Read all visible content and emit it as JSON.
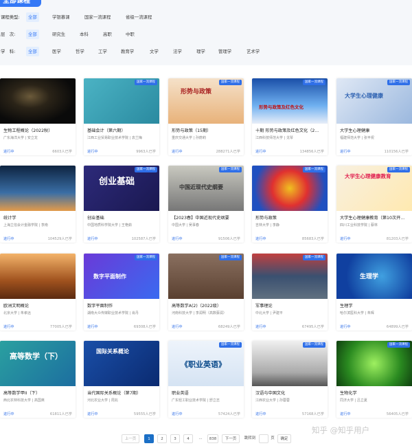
{
  "tab_all": "全部课程",
  "filters": {
    "type": {
      "label": "课程类型:",
      "options": [
        "全部",
        "学银慕课",
        "国家一流课程",
        "省级一流课程"
      ]
    },
    "level": {
      "label": "层　次:",
      "options": [
        "全部",
        "研究生",
        "本科",
        "高职",
        "中职"
      ]
    },
    "subject": {
      "label": "学　科:",
      "options": [
        "全部",
        "医学",
        "哲学",
        "工学",
        "教育学",
        "文学",
        "法学",
        "理学",
        "管理学",
        "艺术学"
      ]
    }
  },
  "badge_label": "国家一流课程",
  "courses": [
    {
      "title": "生物工程概论（2022秋）",
      "uni": "广东海洋大学 | 安立龙",
      "status": "进行中",
      "count": "6603人已学",
      "thumb_text": ""
    },
    {
      "title": "基础会计（第六期）",
      "uni": "江西工业贸易职业技术学院 | 袁兰梅",
      "status": "进行中",
      "count": "9963人已学",
      "thumb_text": ""
    },
    {
      "title": "形势与政策（15期）",
      "uni": "重庆交通大学 | 孙蔚莉",
      "status": "进行中",
      "count": "288271人已学",
      "thumb_text": "形势与政策"
    },
    {
      "title": "十期 形势与政策及红色文化（2...",
      "uni": "江西科技师范大学 | 戈琴",
      "status": "进行中",
      "count": "134856人已学",
      "thumb_text": "形势与政策及红色文化"
    },
    {
      "title": "大学生心理健康",
      "uni": "福建师范大学 | 张丰祝",
      "status": "进行中",
      "count": "110156人已学",
      "thumb_text": "大学生心理健康"
    },
    {
      "title": "统计学",
      "uni": "上海立信会计金融学院 | 李南",
      "status": "进行中",
      "count": "104529人已学",
      "thumb_text": ""
    },
    {
      "title": "创业基础",
      "uni": "中国地质科学院大学 | 王艳茹",
      "status": "进行中",
      "count": "102587人已学",
      "thumb_text": "创业基础"
    },
    {
      "title": "【2023春】中国近现代史纲要",
      "uni": "中国大学 | 吴事春",
      "status": "进行中",
      "count": "91506人已学",
      "thumb_text": "中国近现代史纲要"
    },
    {
      "title": "形势与政策",
      "uni": "吉林大学 | 李静",
      "status": "进行中",
      "count": "85683人已学",
      "thumb_text": ""
    },
    {
      "title": "大学生心理健康教育（第10次开...",
      "uni": "四川工业科技学院 | 蔡林",
      "status": "进行中",
      "count": "81203人已学",
      "thumb_text": "大学生心理健康教育"
    },
    {
      "title": "欧洲文明概论",
      "uni": "北京大学 | 朱孝远",
      "status": "进行中",
      "count": "77005人已学",
      "thumb_text": ""
    },
    {
      "title": "数字平面制作",
      "uni": "湖南大众传媒职业技术学院 | 肖丹",
      "status": "进行中",
      "count": "69308人已学",
      "thumb_text": "数字平面制作"
    },
    {
      "title": "高等数学A(2)（2022级）",
      "uni": "河南科技大学 | 李润明（高数蔡润）",
      "status": "进行中",
      "count": "68249人已学",
      "thumb_text": ""
    },
    {
      "title": "军事理论",
      "uni": "中北大学 | 尹建平",
      "status": "进行中",
      "count": "67495人已学",
      "thumb_text": ""
    },
    {
      "title": "生理学",
      "uni": "哈尔滨医科大学 | 朱辉",
      "status": "进行中",
      "count": "64899人已学",
      "thumb_text": "生理学"
    },
    {
      "title": "高等数学甲II（下）",
      "uni": "西北农林科技大学 | 高国英",
      "status": "进行中",
      "count": "61811人已学",
      "thumb_text": "高等数学（下）"
    },
    {
      "title": "当代国际关系概论（第7期）",
      "uni": "河北农业大学 | 周兆",
      "status": "进行中",
      "count": "59555人已学",
      "thumb_text": "国际关系概论"
    },
    {
      "title": "职业英语",
      "uni": "广东轻工职业技术学院 | 舒立志",
      "status": "进行中",
      "count": "57424人已学",
      "thumb_text": "《职业英语》"
    },
    {
      "title": "汉语与中国文化",
      "uni": "江西农业大学 | 孙蓉蓉",
      "status": "进行中",
      "count": "57168人已学",
      "thumb_text": ""
    },
    {
      "title": "生物化学",
      "uni": "同济大学 | 吕立夏",
      "status": "进行中",
      "count": "56405人已学",
      "thumb_text": ""
    }
  ],
  "pager": {
    "prev": "上一页",
    "pages": [
      "1",
      "2",
      "3",
      "4"
    ],
    "ellipsis": "...",
    "last": "838",
    "next": "下一页",
    "goto": "跳转到",
    "page_unit": "页",
    "confirm": "确定"
  },
  "watermark": "知乎 @知乎用户"
}
